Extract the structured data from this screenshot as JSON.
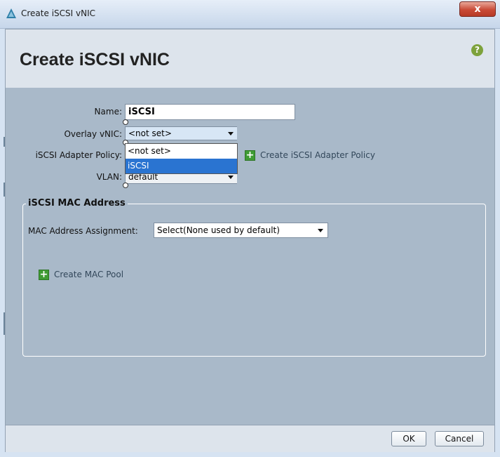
{
  "window": {
    "title": "Create iSCSI vNIC",
    "close_label": "x"
  },
  "header": {
    "title": "Create iSCSI vNIC",
    "help_label": "?"
  },
  "form": {
    "name_label": "Name:",
    "name_value": "iSCSI",
    "overlay_label": "Overlay vNIC:",
    "overlay_value": "<not set>",
    "overlay_options": [
      "<not set>",
      "iSCSI"
    ],
    "adapter_policy_label": "iSCSI Adapter Policy:",
    "create_adapter_policy_label": "Create iSCSI Adapter Policy",
    "vlan_label": "VLAN:",
    "vlan_value": "default"
  },
  "mac_section": {
    "legend": "iSCSI MAC Address",
    "assignment_label": "MAC Address Assignment:",
    "assignment_value": "Select(None used by default)",
    "create_pool_label": "Create MAC Pool"
  },
  "footer": {
    "ok_label": "OK",
    "cancel_label": "Cancel"
  },
  "colors": {
    "body_background": "#a9b9c9",
    "selection": "#2a74d1",
    "add_icon": "#3f9b34"
  }
}
